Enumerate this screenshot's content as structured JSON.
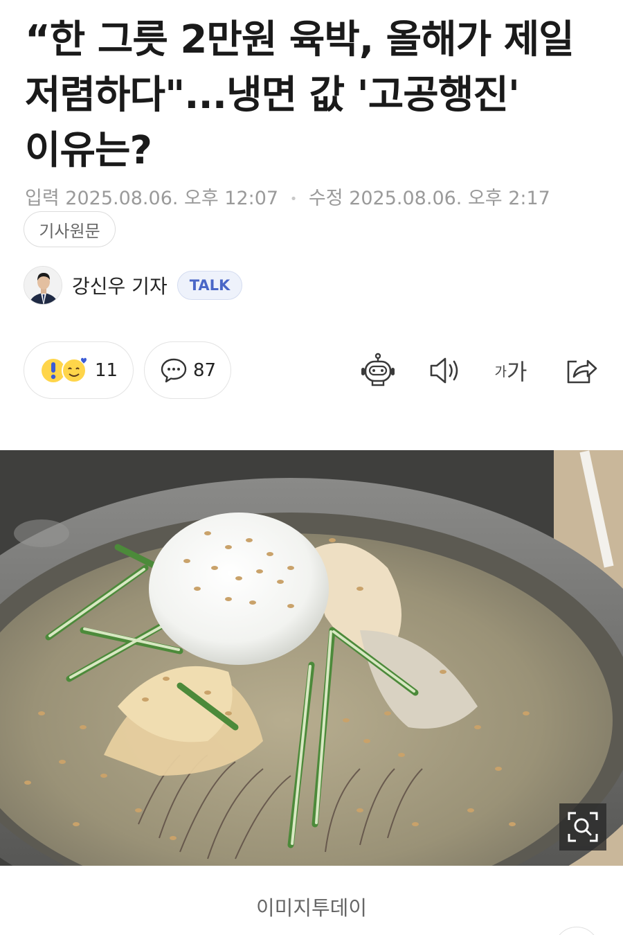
{
  "article": {
    "headline": "“한 그릇 2만원 육박, 올해가 제일 저렴하다\"...냉면 값 '고공행진' 이유는?",
    "input_label": "입력",
    "input_date": "2025.08.06. 오후 12:07",
    "separator": "•",
    "modified_label": "수정",
    "modified_date": "2025.08.06. 오후 2:17",
    "original_button": "기사원문"
  },
  "author": {
    "name": "강신우 기자",
    "talk_badge": "TALK"
  },
  "actions": {
    "reaction_count": "11",
    "comment_count": "87",
    "font_small": "가",
    "font_large": "가"
  },
  "image": {
    "caption": "이미지투데이"
  },
  "colors": {
    "meta_text": "#9a9a9a",
    "talk_text": "#4a67c7",
    "talk_bg": "#eef2fb",
    "icon": "#3a3a3a"
  },
  "icons": [
    "reaction-emoji-icons",
    "comment-icon",
    "ai-robot-icon",
    "speaker-icon",
    "font-size-icon",
    "share-icon",
    "zoom-search-icon"
  ]
}
